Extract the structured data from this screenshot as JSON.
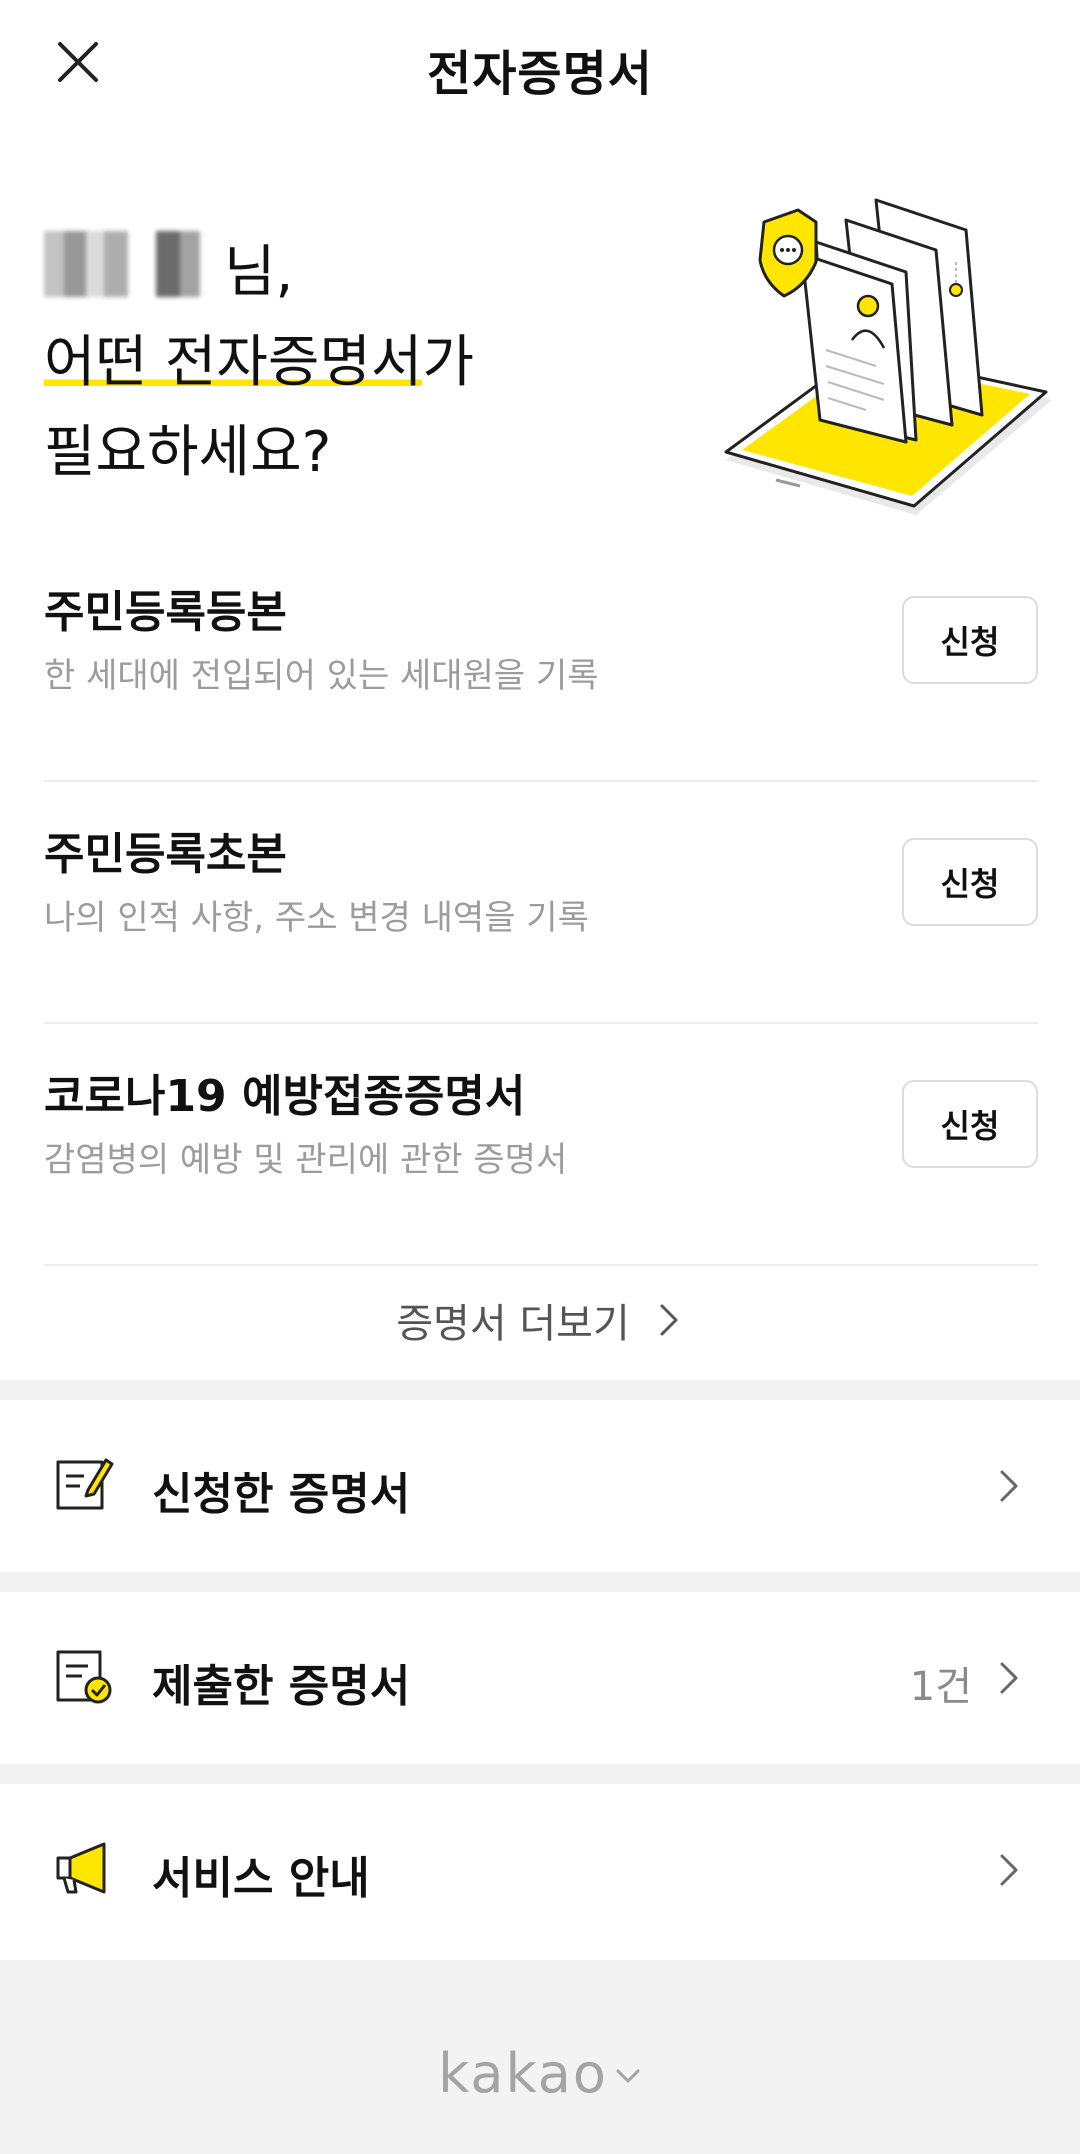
{
  "header": {
    "title": "전자증명서",
    "close_icon": "close-icon"
  },
  "hero": {
    "greeting_suffix": "님,",
    "line2_highlight": "어떤 전자증명서",
    "line2_rest": "가",
    "line3": "필요하세요?",
    "illustration_icon": "certificate-illustration-icon",
    "accent_color": "#FFE600"
  },
  "certificates": [
    {
      "name": "주민등록등본",
      "description": "한 세대에 전입되어 있는 세대원을 기록",
      "button": "신청"
    },
    {
      "name": "주민등록초본",
      "description": "나의 인적 사항, 주소 변경 내역을 기록",
      "button": "신청"
    },
    {
      "name": "코로나19 예방접종증명서",
      "description": "감염병의 예방 및 관리에 관한 증명서",
      "button": "신청"
    }
  ],
  "more": {
    "label": "증명서 더보기"
  },
  "menu": [
    {
      "label": "신청한 증명서",
      "count": "",
      "icon": "edit-document-icon"
    },
    {
      "label": "제출한 증명서",
      "count": "1건",
      "icon": "submitted-document-icon"
    },
    {
      "label": "서비스 안내",
      "count": "",
      "icon": "megaphone-icon"
    }
  ],
  "footer": {
    "brand": "kakao"
  }
}
